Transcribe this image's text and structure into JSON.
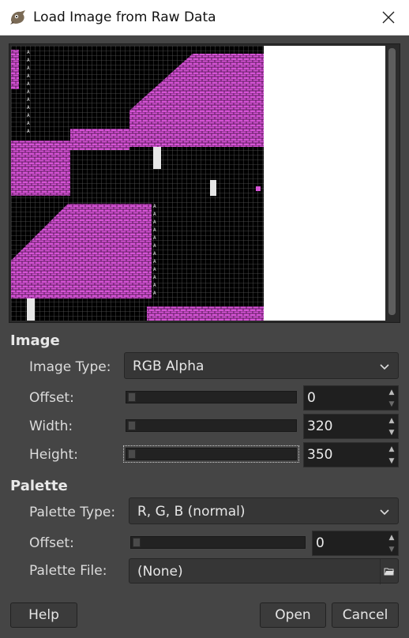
{
  "window": {
    "title": "Load Image from Raw Data",
    "close_icon": "close-icon",
    "app_icon": "gimp-icon"
  },
  "image": {
    "section_title": "Image",
    "image_type_label": "Image Type:",
    "image_type_value": "RGB Alpha",
    "offset_label": "Offset:",
    "offset_value": "0",
    "width_label": "Width:",
    "width_value": "320",
    "height_label": "Height:",
    "height_value": "350"
  },
  "palette": {
    "section_title": "Palette",
    "type_label": "Palette Type:",
    "type_value": "R, G, B (normal)",
    "offset_label": "Offset:",
    "offset_value": "0",
    "file_label": "Palette File:",
    "file_value": "(None)"
  },
  "buttons": {
    "help": "Help",
    "open": "Open",
    "cancel": "Cancel"
  },
  "colors": {
    "background": "#454545",
    "pink": "#d553d5",
    "preview_black": "#000000"
  }
}
